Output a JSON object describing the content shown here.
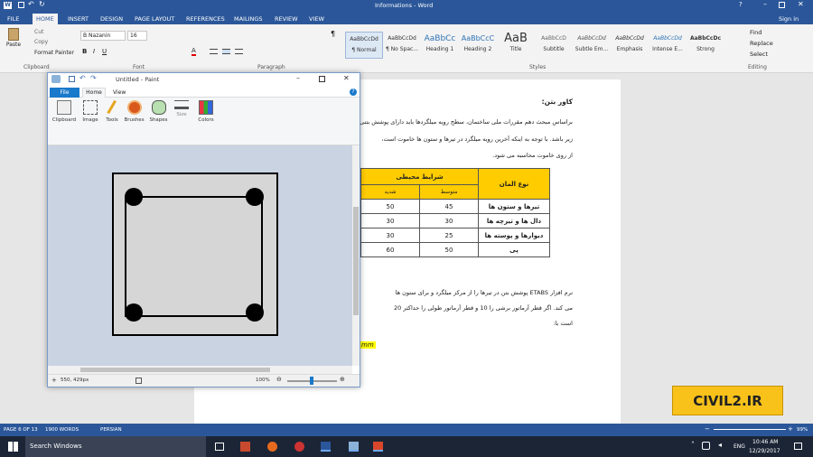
{
  "word": {
    "title": "Informations - Word",
    "user": "Sign in",
    "tabs": [
      "FILE",
      "HOME",
      "INSERT",
      "DESIGN",
      "PAGE LAYOUT",
      "REFERENCES",
      "MAILINGS",
      "REVIEW",
      "VIEW"
    ],
    "clipboard": {
      "paste": "Paste",
      "cut": "Cut",
      "copy": "Copy",
      "format_painter": "Format Painter",
      "label": "Clipboard"
    },
    "font": {
      "name": "B Nazanin",
      "size": "16",
      "label": "Font"
    },
    "paragraph_label": "Paragraph",
    "styles": [
      {
        "preview": "AaBbCcDd",
        "name": "¶ Normal"
      },
      {
        "preview": "AaBbCcDd",
        "name": "¶ No Spac..."
      },
      {
        "preview": "AaBbCc",
        "name": "Heading 1"
      },
      {
        "preview": "AaBbCcC",
        "name": "Heading 2"
      },
      {
        "preview": "AaB",
        "name": "Title"
      },
      {
        "preview": "AaBbCcD",
        "name": "Subtitle"
      },
      {
        "preview": "AaBbCcDd",
        "name": "Subtle Em..."
      },
      {
        "preview": "AaBbCcDd",
        "name": "Emphasis"
      },
      {
        "preview": "AaBbCcDd",
        "name": "Intense E..."
      },
      {
        "preview": "AaBbCcDc",
        "name": "Strong"
      }
    ],
    "styles_label": "Styles",
    "editing": {
      "find": "Find",
      "replace": "Replace",
      "select": "Select",
      "label": "Editing"
    },
    "doc": {
      "heading": "کاور بتن:",
      "para1_l1": "براساس مبحث دهم مقررات ملی ساختمان، سطح رویه میلگردها باید دارای پوشش بتنی",
      "para1_l2": "زیر باشد. با توجه به اینکه آخرین رویه میلگرد در تیرها و ستون ها خاموت است،",
      "para1_l3": "از روی خاموت محاسبه می شود.",
      "table": {
        "col_type": "نوع المان",
        "col_cond": "شرایط محیطی",
        "sub_mid": "متوسط",
        "sub_severe": "شدید",
        "rows": [
          {
            "name": "تیرها و ستون ها",
            "mid": "45",
            "severe": "50"
          },
          {
            "name": "دال ها و تیرچه ها",
            "mid": "30",
            "severe": "30"
          },
          {
            "name": "دیوارها و پوسته ها",
            "mid": "25",
            "severe": "30"
          },
          {
            "name": "پی",
            "mid": "50",
            "severe": "60"
          }
        ]
      },
      "para2_l1": "نرم افزار ETABS پوشش بتن در تیرها را از مرکز میلگرد و برای ستون ها",
      "para2_l2": "می کند. اگر قطر آرماتور برشی را 10 و قطر آرماتور طولی را حداکثر 20",
      "para2_l3": "است با:",
      "mm": "mm"
    },
    "status": {
      "page": "PAGE 6 OF 13",
      "words": "1900 WORDS",
      "lang": "PERSIAN",
      "zoom": "99%"
    }
  },
  "paint": {
    "title": "Untitled - Paint",
    "tabs": [
      "File",
      "Home",
      "View"
    ],
    "tools": [
      "Clipboard",
      "Image",
      "Tools",
      "Brushes",
      "Shapes",
      "Size",
      "Colors"
    ],
    "status": {
      "coords": "550, 429px",
      "zoom": "100%"
    }
  },
  "watermark": "CIVIL2.IR",
  "taskbar": {
    "search": "Search Windows",
    "lang": "ENG",
    "time": "10:46 AM",
    "date": "12/29/2017"
  },
  "colors": {
    "word_blue": "#2b579a",
    "table_header": "#ffcc00",
    "watermark_bg": "#f8c21a"
  }
}
